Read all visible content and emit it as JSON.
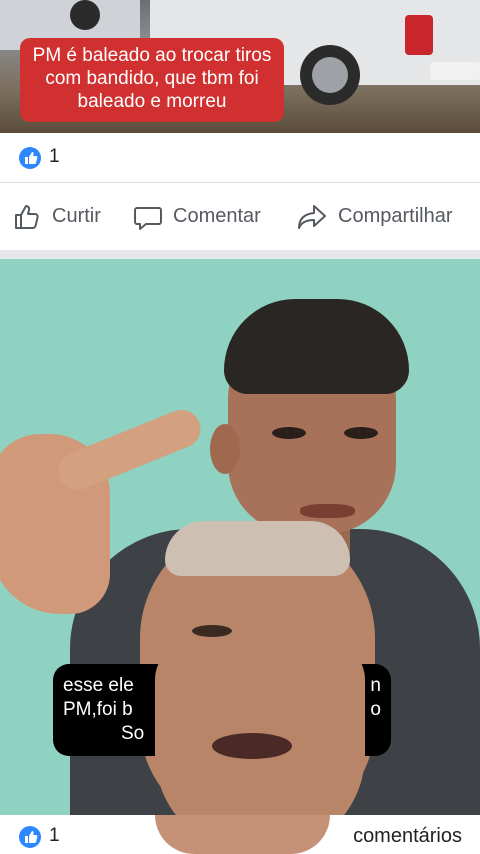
{
  "post_top": {
    "caption": "PM é baleado ao trocar tiros com bandido, que tbm foi baleado e morreu",
    "reaction_icon": "like-icon",
    "reaction_count": "1"
  },
  "actions": {
    "like_label": "Curtir",
    "comment_label": "Comentar",
    "share_label": "Compartilhar"
  },
  "video": {
    "subtitle_line1": "esse ele",
    "subtitle_line1_end": "n",
    "subtitle_line2": "PM,foi b",
    "subtitle_line2_end": "o",
    "subtitle_line3": "So"
  },
  "post_bottom": {
    "reaction_icon": "like-icon",
    "reaction_count": "1",
    "comments_label": "comentários"
  },
  "colors": {
    "accent": "#2d88ff",
    "caption_bg": "#d0302f",
    "wall": "#8fd2c2"
  }
}
